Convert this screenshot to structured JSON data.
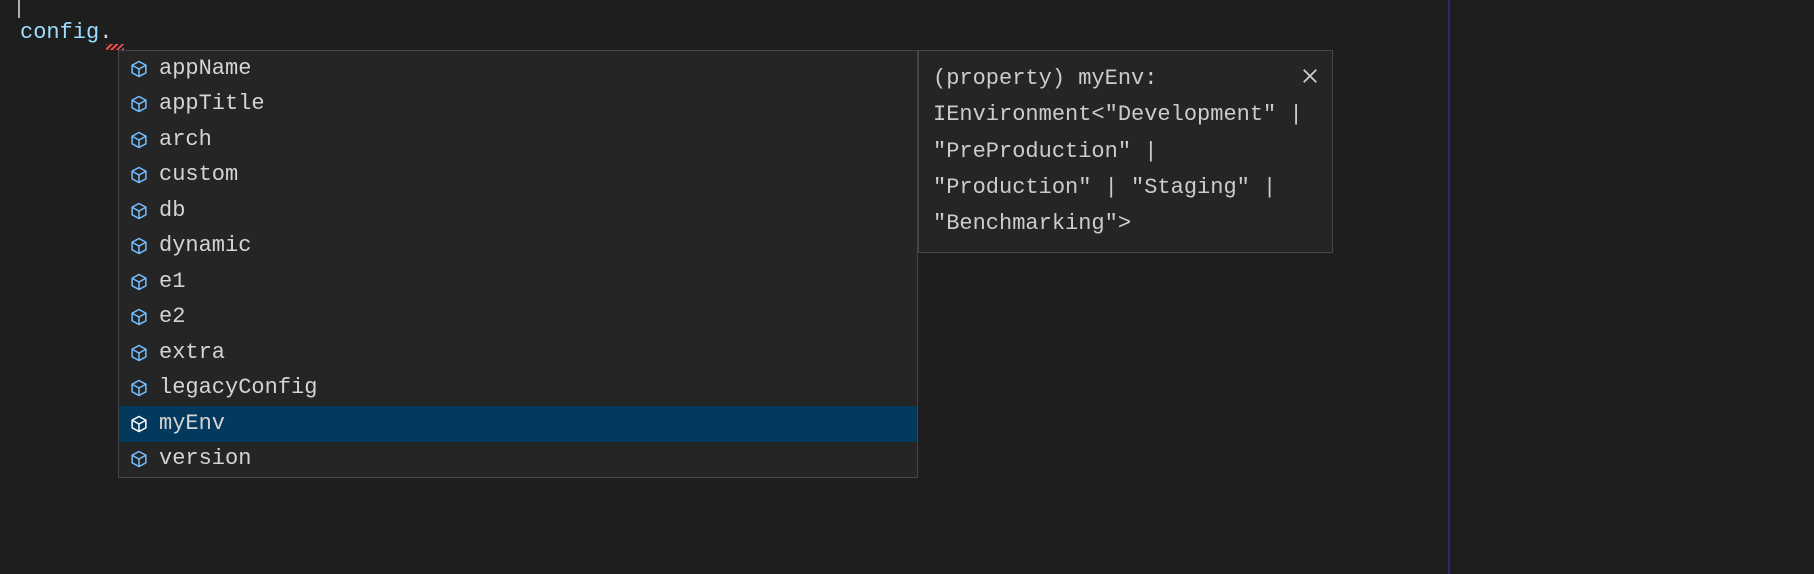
{
  "code": {
    "object": "config",
    "punct": "."
  },
  "suggestions": [
    {
      "label": "appName",
      "selected": false
    },
    {
      "label": "appTitle",
      "selected": false
    },
    {
      "label": "arch",
      "selected": false
    },
    {
      "label": "custom",
      "selected": false
    },
    {
      "label": "db",
      "selected": false
    },
    {
      "label": "dynamic",
      "selected": false
    },
    {
      "label": "e1",
      "selected": false
    },
    {
      "label": "e2",
      "selected": false
    },
    {
      "label": "extra",
      "selected": false
    },
    {
      "label": "legacyConfig",
      "selected": false
    },
    {
      "label": "myEnv",
      "selected": true
    },
    {
      "label": "version",
      "selected": false
    }
  ],
  "details": {
    "text": "(property) myEnv: IEnvironment<\"Development\" | \"PreProduction\" | \"Production\" | \"Staging\" | \"Benchmarking\">"
  }
}
